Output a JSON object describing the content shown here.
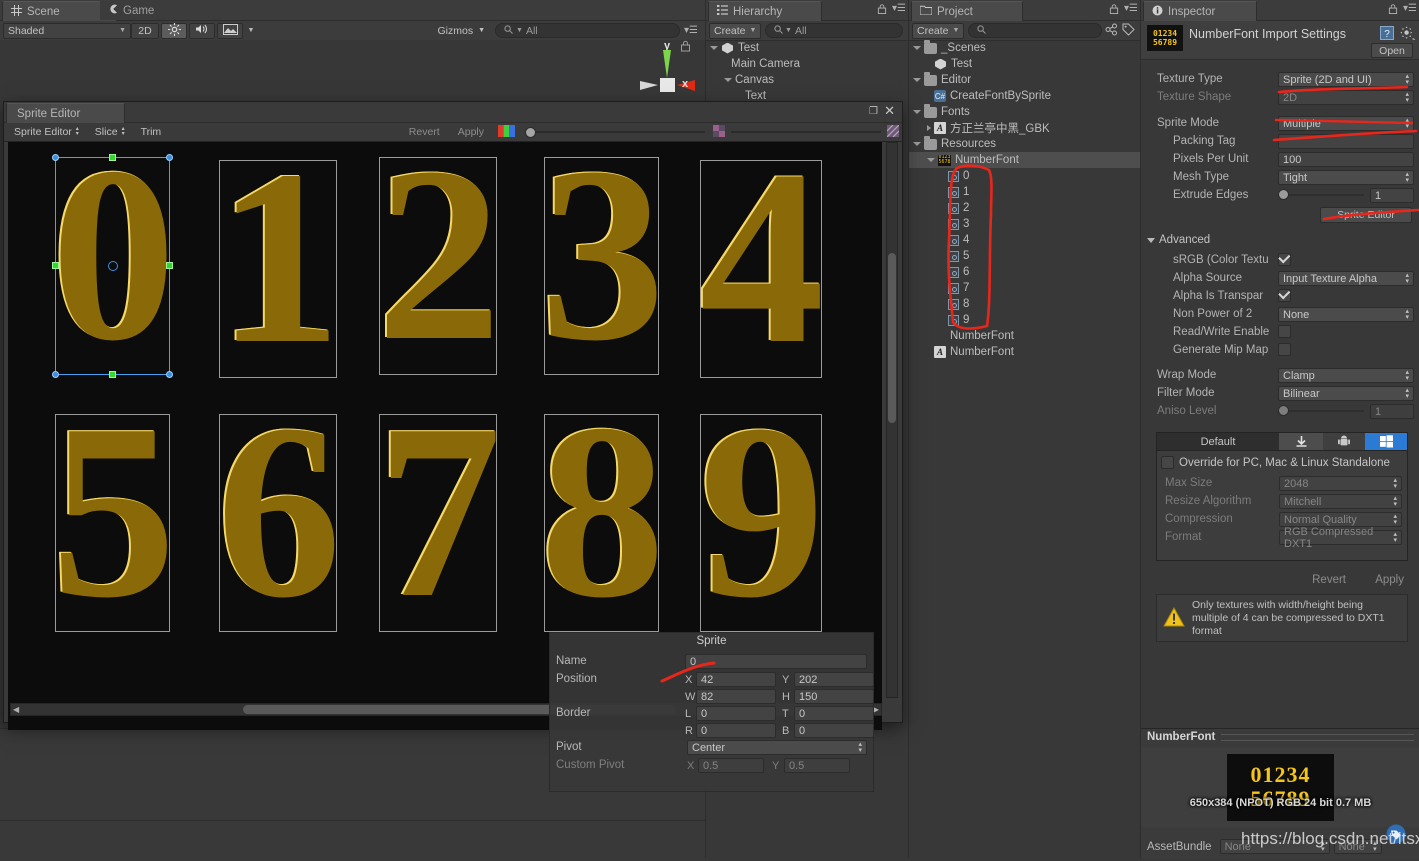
{
  "scene_panel": {
    "tabs": [
      {
        "label": "Scene",
        "icon": "grid-icon",
        "active": true
      },
      {
        "label": "Game",
        "icon": "gamepad-icon",
        "active": false
      }
    ],
    "toolbar": {
      "shading": "Shaded",
      "mode_2d": "2D",
      "light_icon": "sun-icon",
      "audio_icon": "speaker-icon",
      "fx_icon": "image-icon",
      "gizmos": "Gizmos",
      "search_placeholder": "All",
      "search_icon": "search-icon"
    },
    "gizmo": {
      "y_axis": "y",
      "x_axis": "x",
      "lock_icon": "lock-icon"
    }
  },
  "hierarchy_panel": {
    "tab": "Hierarchy",
    "tab_icon": "hierarchy-icon",
    "create_label": "Create",
    "search_placeholder": "All",
    "items": [
      {
        "label": "Test",
        "depth": 0,
        "icon": "unity-scene-icon",
        "expanded": true
      },
      {
        "label": "Main Camera",
        "depth": 1,
        "icon": "none"
      },
      {
        "label": "Canvas",
        "depth": 1,
        "icon": "none",
        "expanded": true
      },
      {
        "label": "Text",
        "depth": 2,
        "icon": "none"
      }
    ]
  },
  "project_panel": {
    "tab": "Project",
    "tab_icon": "folder-icon",
    "create_label": "Create",
    "search_placeholder": "",
    "items": [
      {
        "label": "_Scenes",
        "depth": 0,
        "icon": "folder-icon",
        "expanded": true
      },
      {
        "label": "Test",
        "depth": 1,
        "icon": "unity-scene-icon"
      },
      {
        "label": "Editor",
        "depth": 0,
        "icon": "folder-icon",
        "expanded": true
      },
      {
        "label": "CreateFontBySprite",
        "depth": 1,
        "icon": "csharp-icon"
      },
      {
        "label": "Fonts",
        "depth": 0,
        "icon": "folder-icon",
        "expanded": true
      },
      {
        "label": "方正兰亭中黑_GBK",
        "depth": 1,
        "icon": "font-icon",
        "collapsed": true
      },
      {
        "label": "Resources",
        "depth": 0,
        "icon": "folder-icon",
        "expanded": true
      },
      {
        "label": "NumberFont",
        "depth": 1,
        "icon": "texture-icon",
        "expanded": true,
        "selected": true
      },
      {
        "label": "0",
        "depth": 2,
        "icon": "sprite-icon"
      },
      {
        "label": "1",
        "depth": 2,
        "icon": "sprite-icon"
      },
      {
        "label": "2",
        "depth": 2,
        "icon": "sprite-icon"
      },
      {
        "label": "3",
        "depth": 2,
        "icon": "sprite-icon"
      },
      {
        "label": "4",
        "depth": 2,
        "icon": "sprite-icon"
      },
      {
        "label": "5",
        "depth": 2,
        "icon": "sprite-icon"
      },
      {
        "label": "6",
        "depth": 2,
        "icon": "sprite-icon"
      },
      {
        "label": "7",
        "depth": 2,
        "icon": "sprite-icon"
      },
      {
        "label": "8",
        "depth": 2,
        "icon": "sprite-icon"
      },
      {
        "label": "9",
        "depth": 2,
        "icon": "sprite-icon"
      },
      {
        "label": "NumberFont",
        "depth": 1,
        "icon": "material-icon"
      },
      {
        "label": "NumberFont",
        "depth": 1,
        "icon": "font-icon"
      }
    ]
  },
  "inspector": {
    "tab": "Inspector",
    "tab_icon": "info-icon",
    "title": "NumberFont Import Settings",
    "help_icon": "help-icon",
    "gear_icon": "gear-icon",
    "open_button": "Open",
    "fields": [
      {
        "label": "Texture Type",
        "value": "Sprite (2D and UI)",
        "type": "popup",
        "dim": false
      },
      {
        "label": "Texture Shape",
        "value": "2D",
        "type": "popup",
        "dim": true
      },
      {
        "label": "Sprite Mode",
        "value": "Multiple",
        "type": "popup",
        "dim": false
      },
      {
        "label": "Packing Tag",
        "value": "",
        "type": "text",
        "dim": false
      },
      {
        "label": "Pixels Per Unit",
        "value": "100",
        "type": "text",
        "dim": false
      },
      {
        "label": "Mesh Type",
        "value": "Tight",
        "type": "popup",
        "dim": false
      },
      {
        "label": "Extrude Edges",
        "value": "1",
        "type": "slider",
        "dim": false
      }
    ],
    "sprite_editor_button": "Sprite Editor",
    "advanced": {
      "header": "Advanced",
      "fields": [
        {
          "label": "sRGB (Color Textu",
          "value": "",
          "type": "checkbox",
          "checked": true
        },
        {
          "label": "Alpha Source",
          "value": "Input Texture Alpha",
          "type": "popup"
        },
        {
          "label": "Alpha Is Transpar",
          "value": "",
          "type": "checkbox",
          "checked": true
        },
        {
          "label": "Non Power of 2",
          "value": "None",
          "type": "popup"
        },
        {
          "label": "Read/Write Enable",
          "value": "",
          "type": "checkbox",
          "checked": false
        },
        {
          "label": "Generate Mip Map",
          "value": "",
          "type": "checkbox",
          "checked": false
        }
      ]
    },
    "common": [
      {
        "label": "Wrap Mode",
        "value": "Clamp",
        "type": "popup",
        "dim": false
      },
      {
        "label": "Filter Mode",
        "value": "Bilinear",
        "type": "popup",
        "dim": false
      },
      {
        "label": "Aniso Level",
        "value": "1",
        "type": "slider",
        "dim": true
      }
    ],
    "platform": {
      "tabs": [
        {
          "label": "Default",
          "icon": "default-icon",
          "active": true
        },
        {
          "label": "",
          "icon": "standalone-icon",
          "active": false
        },
        {
          "label": "",
          "icon": "android-icon",
          "active": false
        },
        {
          "label": "",
          "icon": "windows-icon",
          "active": false
        }
      ],
      "override_label": "Override for PC, Mac & Linux Standalone",
      "override_checked": false,
      "fields": [
        {
          "label": "Max Size",
          "value": "2048"
        },
        {
          "label": "Resize Algorithm",
          "value": "Mitchell"
        },
        {
          "label": "Compression",
          "value": "Normal Quality"
        },
        {
          "label": "Format",
          "value": "RGB Compressed DXT1"
        }
      ],
      "revert_label": "Revert",
      "apply_label": "Apply"
    },
    "warning": {
      "icon": "warning-icon",
      "text": "Only textures with width/height being multiple of 4 can be compressed to DXT1 format"
    },
    "preview": {
      "title": "NumberFont",
      "info": "650x384 (NPOT)  RGB 24 bit   0.7 MB",
      "digits_row1": "01234",
      "digits_row2": "56789",
      "assetbundle_label": "AssetBundle",
      "assetbundle_value": "None",
      "assetbundle_variant": "None",
      "tag_icon": "tag-icon",
      "watermark": "https://blog.csdn.net/itsxwz"
    }
  },
  "sprite_editor": {
    "tab": "Sprite Editor",
    "menu": [
      {
        "label": "Sprite Editor",
        "popup": true
      },
      {
        "label": "Slice",
        "popup": true
      },
      {
        "label": "Trim",
        "popup": false
      }
    ],
    "revert_label": "Revert",
    "apply_label": "Apply",
    "rgb_icon": "rgb-channel-icon",
    "alpha_icon": "alpha-icon",
    "checker_icon": "checker-icon",
    "minimize_icon": "minimize-icon",
    "close_icon": "close-icon",
    "menu_icon": "hamburger-icon",
    "canvas": {
      "background": "#0c0c0c",
      "digits_row1": [
        "0",
        "1",
        "2",
        "3",
        "4"
      ],
      "digits_row2": [
        "5",
        "6",
        "7",
        "8",
        "9"
      ],
      "selected_index": 0
    },
    "properties": {
      "header": "Sprite",
      "name_label": "Name",
      "name_value": "0",
      "position_label": "Position",
      "position": {
        "x_label": "X",
        "x": "42",
        "y_label": "Y",
        "y": "202",
        "w_label": "W",
        "w": "82",
        "h_label": "H",
        "h": "150"
      },
      "border_label": "Border",
      "border": {
        "l_label": "L",
        "l": "0",
        "t_label": "T",
        "t": "0",
        "r_label": "R",
        "r": "0",
        "b_label": "B",
        "b": "0"
      },
      "pivot_label": "Pivot",
      "pivot_value": "Center",
      "custom_pivot_label": "Custom Pivot",
      "custom_pivot": {
        "x_label": "X",
        "x": "0.5",
        "y_label": "Y",
        "y": "0.5"
      }
    }
  },
  "colors": {
    "accent_yellow": "#F5C518",
    "selection_blue": "#3b8fe0",
    "pivot_green": "#35d62f",
    "annotation_red": "#e8271c",
    "panel_bg": "#383838",
    "canvas_bg": "#0c0c0c"
  }
}
